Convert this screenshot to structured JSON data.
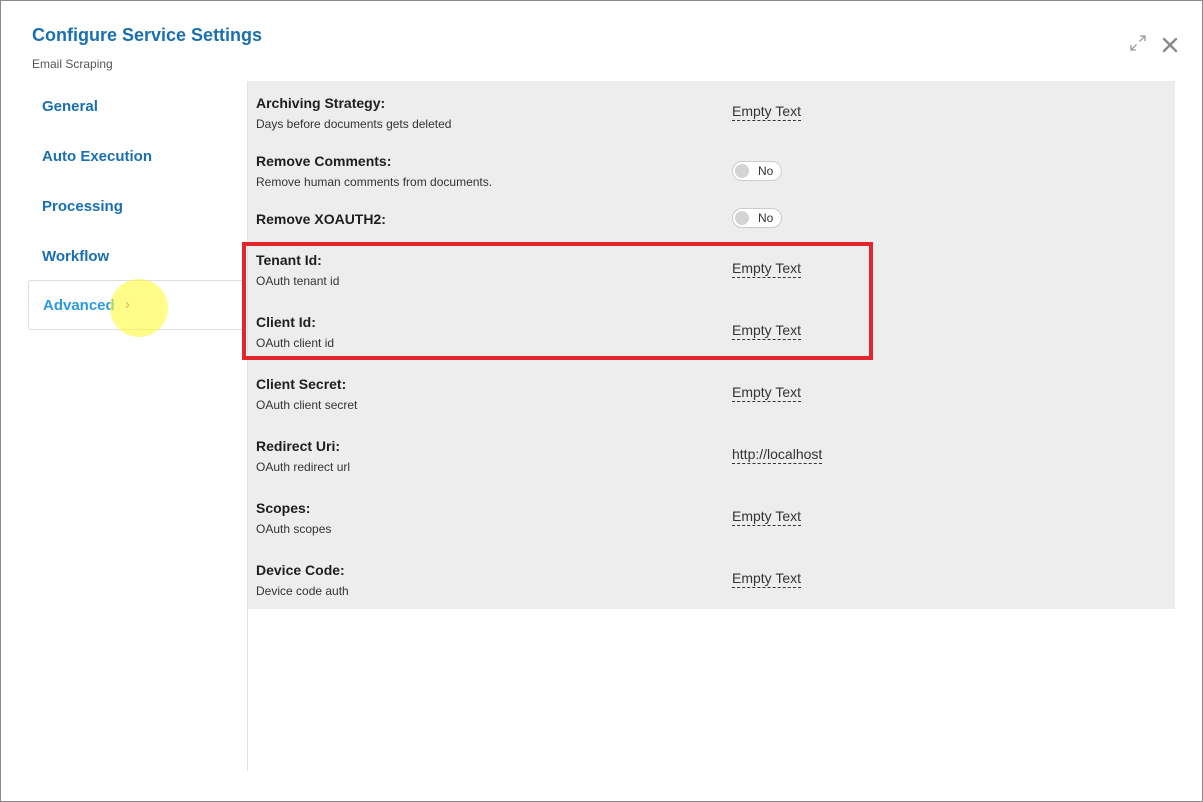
{
  "header": {
    "title": "Configure Service Settings",
    "subtitle": "Email Scraping"
  },
  "window_controls": {
    "expand_icon": "expand-icon",
    "close_icon": "close-icon"
  },
  "sidebar": {
    "items": [
      {
        "label": "General",
        "active": false
      },
      {
        "label": "Auto Execution",
        "active": false
      },
      {
        "label": "Processing",
        "active": false
      },
      {
        "label": "Workflow",
        "active": false
      },
      {
        "label": "Advanced",
        "active": true
      }
    ],
    "active_chevron": "›"
  },
  "settings": [
    {
      "label": "Archiving Strategy:",
      "description": "Days before documents gets deleted",
      "type": "text",
      "value": "Empty Text"
    },
    {
      "label": "Remove Comments:",
      "description": "Remove human comments from documents.",
      "type": "toggle",
      "value": "No"
    },
    {
      "label": "Remove XOAUTH2:",
      "description": "",
      "type": "toggle",
      "value": "No"
    },
    {
      "label": "Tenant Id:",
      "description": "OAuth tenant id",
      "type": "text",
      "value": "Empty Text"
    },
    {
      "label": "Client Id:",
      "description": "OAuth client id",
      "type": "text",
      "value": "Empty Text"
    },
    {
      "label": "Client Secret:",
      "description": "OAuth client secret",
      "type": "text",
      "value": "Empty Text"
    },
    {
      "label": "Redirect Uri:",
      "description": "OAuth redirect url",
      "type": "text",
      "value": "http://localhost"
    },
    {
      "label": "Scopes:",
      "description": "OAuth scopes",
      "type": "text",
      "value": "Empty Text"
    },
    {
      "label": "Device Code:",
      "description": "Device code auth",
      "type": "text",
      "value": "Empty Text"
    }
  ],
  "colors": {
    "accent": "#1a6fb0",
    "active_nav": "#2b9be0",
    "panel_background": "#ededed",
    "callout_border": "#e3262d",
    "cursor_highlight": "#fffa3c"
  }
}
